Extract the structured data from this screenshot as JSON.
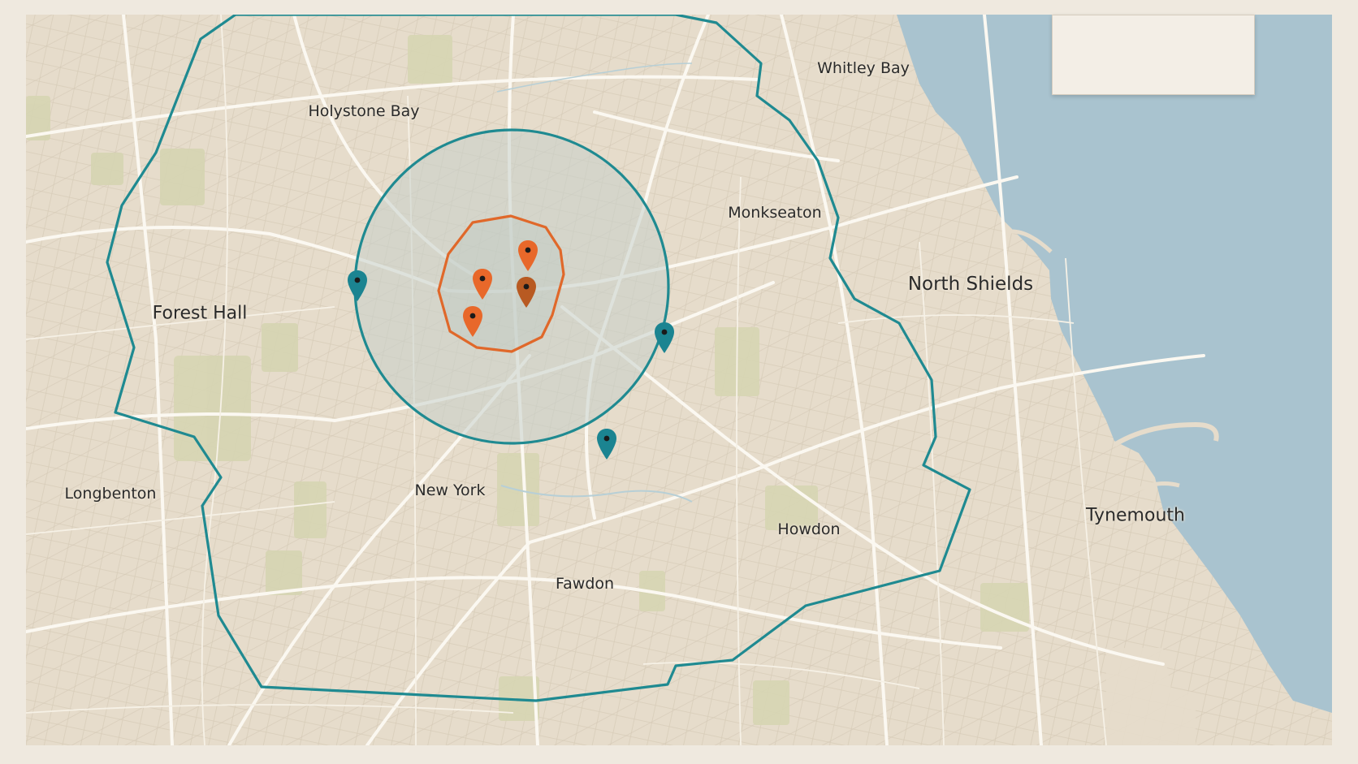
{
  "map": {
    "colors": {
      "land": "#e6dccb",
      "water": "#a9c3cf",
      "roads_major": "#fbf8f1",
      "roads_minor": "#d4c9b6",
      "parks": "#d6d5b2",
      "outer_boundary": "#1f8a91",
      "inner_circle": "#1f8a91",
      "core_boundary": "#e0682a",
      "core_fill": "#bfc9c4",
      "pin_teal": "#1b8491",
      "pin_orange": "#e8682a",
      "pin_dark_orange": "#b85a22"
    },
    "places": [
      {
        "id": "whitley-bay",
        "name": "Whitley Bay",
        "size": "small"
      },
      {
        "id": "holystone-bay",
        "name": "Holystone Bay",
        "size": "small"
      },
      {
        "id": "monkseaton",
        "name": "Monkseaton",
        "size": "small"
      },
      {
        "id": "north-shields",
        "name": "North Shields",
        "size": "xl"
      },
      {
        "id": "forest-hall",
        "name": "Forest Hall",
        "size": "large"
      },
      {
        "id": "longbenton",
        "name": "Longbenton",
        "size": "small"
      },
      {
        "id": "new-york",
        "name": "New York",
        "size": "small"
      },
      {
        "id": "howdon",
        "name": "Howdon",
        "size": "small"
      },
      {
        "id": "fawdon",
        "name": "Fawdon",
        "size": "small"
      },
      {
        "id": "tynemouth",
        "name": "Tynemouth",
        "size": "large"
      }
    ],
    "legend": {
      "text": ""
    },
    "markers": [
      {
        "id": "teal-pin-west",
        "color": "teal"
      },
      {
        "id": "teal-pin-east",
        "color": "teal"
      },
      {
        "id": "teal-pin-south",
        "color": "teal"
      },
      {
        "id": "orange-pin-1",
        "color": "orange"
      },
      {
        "id": "orange-pin-2",
        "color": "orange"
      },
      {
        "id": "orange-pin-3",
        "color": "dark-orange"
      },
      {
        "id": "orange-pin-4",
        "color": "orange"
      }
    ]
  }
}
